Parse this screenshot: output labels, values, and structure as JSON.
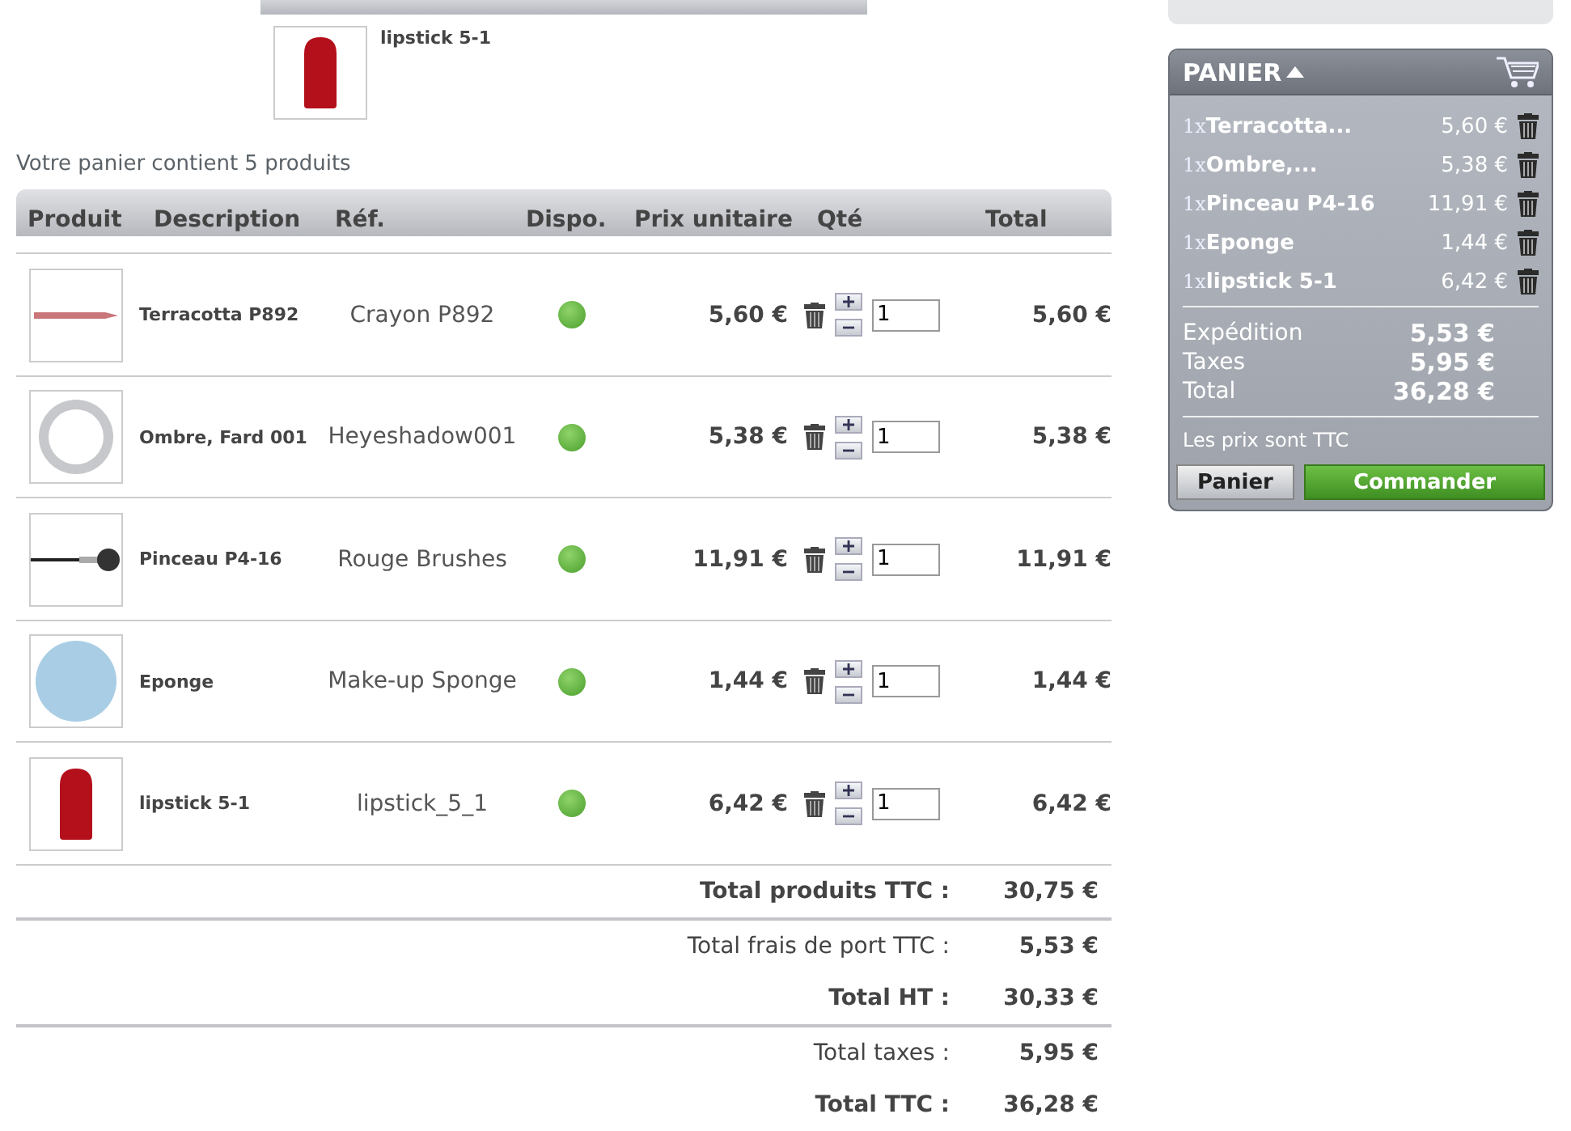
{
  "last_added": {
    "name": "lipstick 5-1"
  },
  "cart_summary": "Votre panier contient 5 produits",
  "table": {
    "columns": [
      "Produit",
      "Description",
      "Réf.",
      "Dispo.",
      "Prix unitaire",
      "Qté",
      "Total"
    ],
    "rows": [
      {
        "description": "Terracotta P892",
        "reference": "Crayon P892",
        "available": true,
        "unit_price": "5,60 €",
        "quantity": "1",
        "total": "5,60 €"
      },
      {
        "description": "Ombre, Fard 001",
        "reference": "Heyeshadow001",
        "available": true,
        "unit_price": "5,38 €",
        "quantity": "1",
        "total": "5,38 €"
      },
      {
        "description": "Pinceau P4-16",
        "reference": "Rouge Brushes",
        "available": true,
        "unit_price": "11,91 €",
        "quantity": "1",
        "total": "11,91 €"
      },
      {
        "description": "Eponge",
        "reference": "Make-up Sponge",
        "available": true,
        "unit_price": "1,44 €",
        "quantity": "1",
        "total": "1,44 €"
      },
      {
        "description": "lipstick 5-1",
        "reference": "lipstick_5_1",
        "available": true,
        "unit_price": "6,42 €",
        "quantity": "1",
        "total": "6,42 €"
      }
    ]
  },
  "totals": [
    {
      "rows": [
        {
          "label": "Total produits TTC :",
          "value": "30,75 €",
          "bold": true
        }
      ]
    },
    {
      "rows": [
        {
          "label": "Total frais de port TTC :",
          "value": "5,53 €",
          "bold": false
        },
        {
          "label": "Total HT :",
          "value": "30,33 €",
          "bold": true
        }
      ]
    },
    {
      "rows": [
        {
          "label": "Total taxes :",
          "value": "5,95 €",
          "bold": false
        },
        {
          "label": "Total TTC :",
          "value": "36,28 €",
          "bold": true
        }
      ]
    }
  ],
  "mini_cart": {
    "title": "PANIER",
    "expanded": true,
    "items": [
      {
        "qty": "1x",
        "name": "Terracotta...",
        "price": "5,60 €"
      },
      {
        "qty": "1x",
        "name": "Ombre,...",
        "price": "5,38 €"
      },
      {
        "qty": "1x",
        "name": "Pinceau P4-16",
        "price": "11,91 €"
      },
      {
        "qty": "1x",
        "name": "Eponge",
        "price": "1,44 €"
      },
      {
        "qty": "1x",
        "name": "lipstick 5-1",
        "price": "6,42 €"
      }
    ],
    "summary": [
      {
        "label": "Expédition",
        "value": "5,53 €"
      },
      {
        "label": "Taxes",
        "value": "5,95 €"
      },
      {
        "label": "Total",
        "value": "36,28 €"
      }
    ],
    "note": "Les prix sont TTC",
    "buttons": [
      {
        "label": "Panier",
        "kind": "secondary"
      },
      {
        "label": "Commander",
        "kind": "primary"
      }
    ]
  }
}
